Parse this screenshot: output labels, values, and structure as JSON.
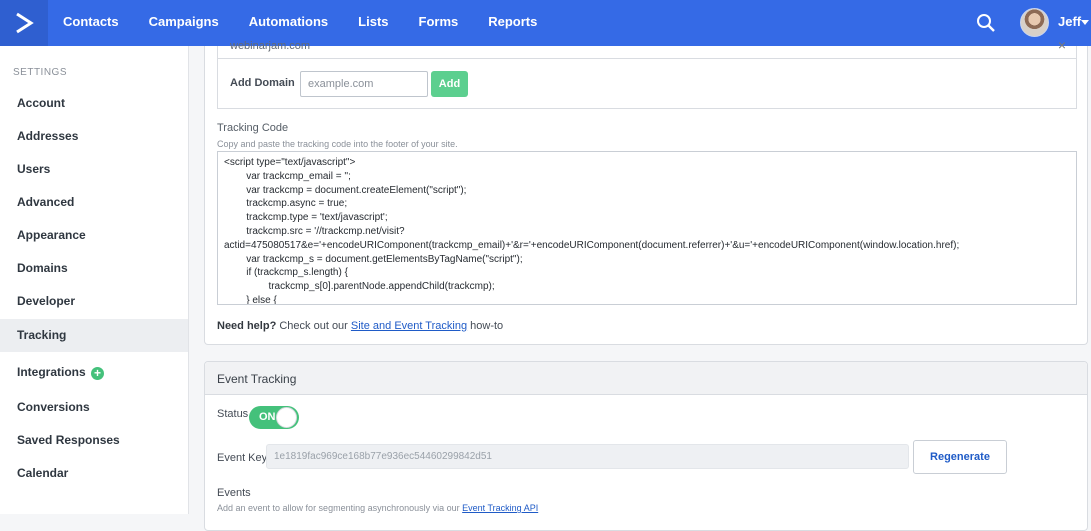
{
  "nav": {
    "items": [
      "Contacts",
      "Campaigns",
      "Automations",
      "Lists",
      "Forms",
      "Reports"
    ],
    "user": "Jeff"
  },
  "sidebar": {
    "header": "SETTINGS",
    "items": [
      "Account",
      "Addresses",
      "Users",
      "Advanced",
      "Appearance",
      "Domains",
      "Developer",
      "Tracking",
      "Integrations",
      "Conversions",
      "Saved Responses",
      "Calendar"
    ],
    "active": "Tracking"
  },
  "domains": {
    "existing": "webinarjam.com",
    "add_label": "Add Domain",
    "input_placeholder": "example.com",
    "add_button": "Add"
  },
  "tracking_code": {
    "title": "Tracking Code",
    "subtitle": "Copy and paste the tracking code into the footer of your site.",
    "lines": [
      "<script type=\"text/javascript\">",
      "        var trackcmp_email = '';",
      "        var trackcmp = document.createElement(\"script\");",
      "        trackcmp.async = true;",
      "        trackcmp.type = 'text/javascript';",
      "        trackcmp.src = '//trackcmp.net/visit?",
      "actid=475080517&e='+encodeURIComponent(trackcmp_email)+'&r='+encodeURIComponent(document.referrer)+'&u='+encodeURIComponent(window.location.href);",
      "        var trackcmp_s = document.getElementsByTagName(\"script\");",
      "        if (trackcmp_s.length) {",
      "                trackcmp_s[0].parentNode.appendChild(trackcmp);",
      "        } else {"
    ]
  },
  "help": {
    "prefix": "Need help?",
    "middle": "Check out our",
    "link": "Site and Event Tracking",
    "suffix": "how-to"
  },
  "event_tracking": {
    "title": "Event Tracking",
    "status_label": "Status",
    "status_value": "ON",
    "key_label": "Event Key",
    "key_value": "1e1819fac969ce168b77e936ec54460299842d51",
    "regenerate_button": "Regenerate",
    "events_label": "Events",
    "events_sub": "Add an event to allow for segmenting asynchronously via our",
    "events_link": "Event Tracking API"
  },
  "colors": {
    "brand": "#356ae6",
    "success": "#44c17b",
    "link": "#1f5bc7"
  }
}
